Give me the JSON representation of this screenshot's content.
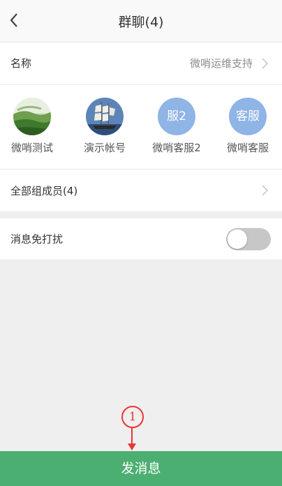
{
  "header": {
    "title": "群聊(4)"
  },
  "group_name": {
    "label": "名称",
    "value": "微哨运维支持"
  },
  "members": [
    {
      "name": "微哨测试",
      "avatar": "landscape-photo"
    },
    {
      "name": "演示帐号",
      "avatar": "sailing-ship-photo"
    },
    {
      "name": "微哨客服2",
      "avatar_text": "服2"
    },
    {
      "name": "微哨客服",
      "avatar_text": "客服"
    }
  ],
  "all_members": {
    "label": "全部组成员(4)"
  },
  "mute": {
    "label": "消息免打扰",
    "enabled": false
  },
  "send_button": {
    "label": "发消息"
  },
  "annotation": {
    "number": "1"
  },
  "colors": {
    "accent": "#4caf72",
    "annotation": "#ee3333",
    "avatar_blue": "#8fb4e6"
  }
}
